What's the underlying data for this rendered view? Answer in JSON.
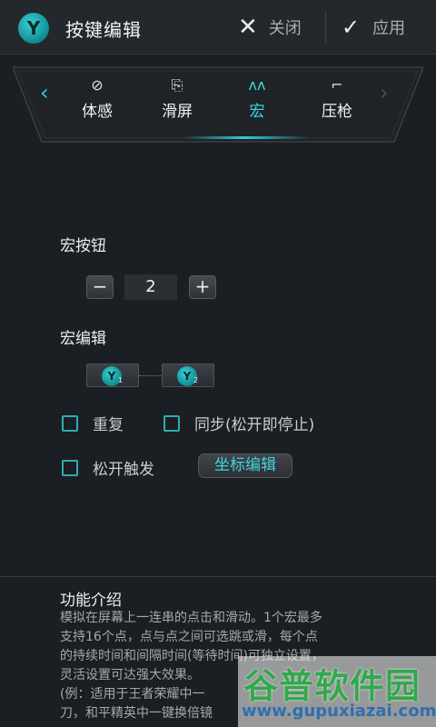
{
  "header": {
    "title": "按键编辑",
    "close_label": "关闭",
    "apply_label": "应用",
    "logo_letter": "Y"
  },
  "tabs": {
    "items": [
      {
        "label": "体感",
        "icon": "link-icon",
        "glyph": "⊘"
      },
      {
        "label": "滑屏",
        "icon": "swipe-icon",
        "glyph": "⎘"
      },
      {
        "label": "宏",
        "icon": "macro-icon",
        "glyph": "ʌʌ",
        "active": true
      },
      {
        "label": "压枪",
        "icon": "gun-icon",
        "glyph": "⌐"
      }
    ],
    "left_arrow": "‹",
    "right_arrow": "›"
  },
  "macro_button": {
    "label": "宏按钮",
    "minus": "−",
    "value": "2",
    "plus": "+"
  },
  "macro_edit": {
    "label": "宏编辑",
    "nodes": [
      {
        "letter": "Y",
        "index": "1"
      },
      {
        "letter": "Y",
        "index": "2"
      }
    ]
  },
  "options": {
    "repeat": "重复",
    "sync": "同步(松开即停止)",
    "release_trigger": "松开触发",
    "coord_edit": "坐标编辑"
  },
  "intro": {
    "title": "功能介绍",
    "lines": [
      "模拟在屏幕上一连串的点击和滑动。1个宏最多",
      "支持16个点，点与点之间可选跳或滑，每个点",
      "的持续时间和间隔时间(等待时间)可独立设置，",
      "灵活设置可达强大效果。",
      "(例：适用于王者荣耀中一",
      "刀，和平精英中一键换倍镜"
    ]
  },
  "watermark": {
    "name": "谷普软件园",
    "url": "www.gupuxiazai.com"
  },
  "colors": {
    "accent": "#2fd0d6",
    "background": "#1b1e23",
    "header": "#24282d"
  }
}
